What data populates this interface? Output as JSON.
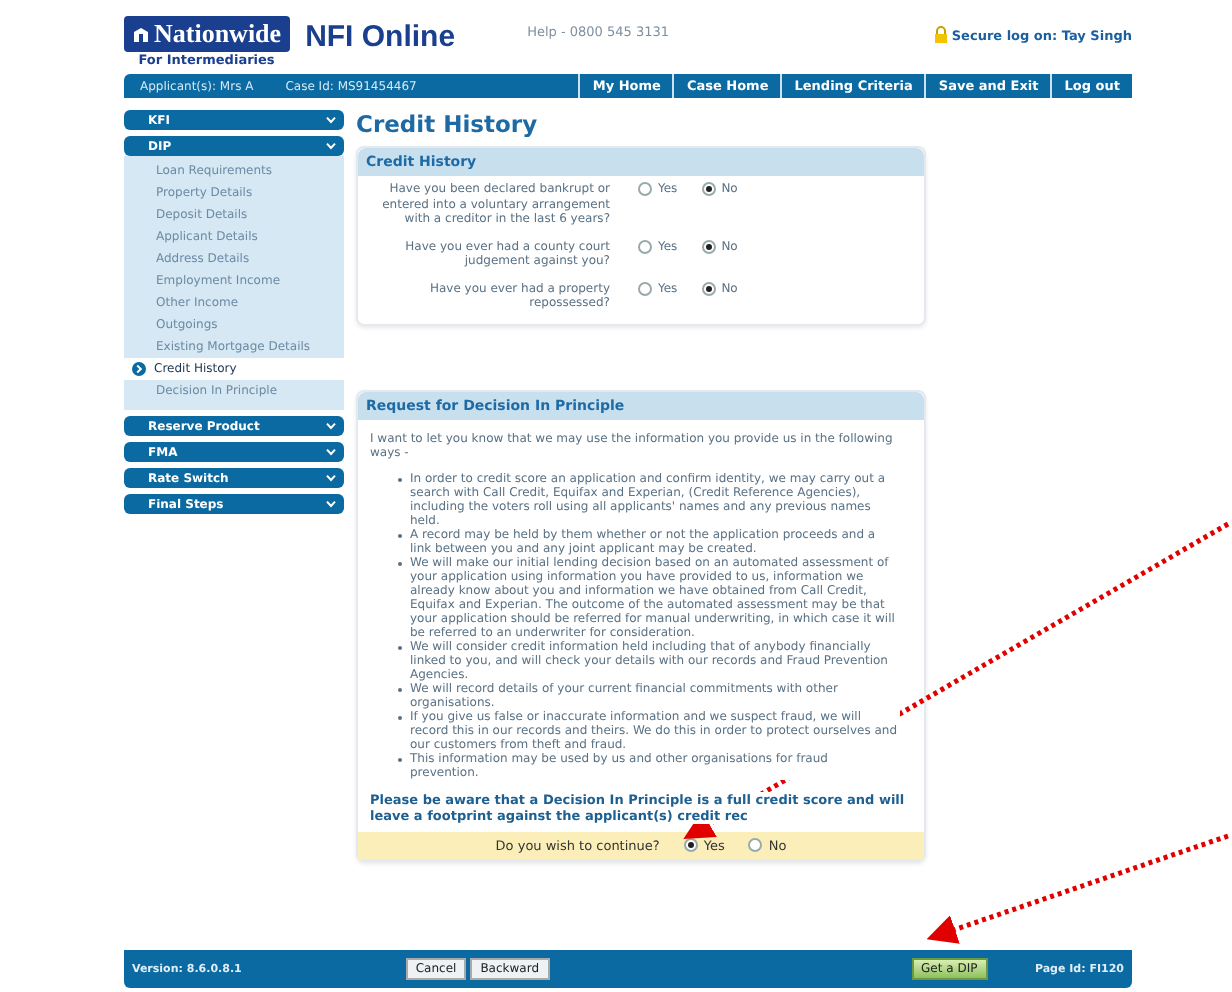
{
  "header": {
    "logo_brand": "Nationwide",
    "logo_sub": "For Intermediaries",
    "app_name": "NFI Online",
    "help": "Help - 0800 545 3131",
    "secure": "Secure log on: Tay Singh"
  },
  "info_bar": {
    "applicant": "Applicant(s): Mrs A",
    "case_id": "Case Id: MS91454467",
    "links": [
      "My Home",
      "Case Home",
      "Lending Criteria",
      "Save and Exit",
      "Log out"
    ]
  },
  "sidebar": [
    {
      "label": "KFI"
    },
    {
      "label": "DIP",
      "children": [
        {
          "label": "Loan Requirements",
          "selected": false
        },
        {
          "label": "Property Details",
          "selected": false
        },
        {
          "label": "Deposit Details",
          "selected": false
        },
        {
          "label": "Applicant Details",
          "selected": false
        },
        {
          "label": "Address Details",
          "selected": false
        },
        {
          "label": "Employment Income",
          "selected": false
        },
        {
          "label": "Other Income",
          "selected": false
        },
        {
          "label": "Outgoings",
          "selected": false
        },
        {
          "label": "Existing Mortgage Details",
          "selected": false
        },
        {
          "label": "Credit History",
          "selected": true
        },
        {
          "label": "Decision In Principle",
          "selected": false
        }
      ]
    },
    {
      "label": "Reserve Product"
    },
    {
      "label": "FMA"
    },
    {
      "label": "Rate Switch"
    },
    {
      "label": "Final Steps"
    }
  ],
  "page_title": "Credit History",
  "credit_history": {
    "title": "Credit History",
    "questions": [
      {
        "text": "Have you been declared bankrupt or entered into a voluntary arrangement with a creditor in the last 6 years?",
        "options": [
          {
            "label": "Yes",
            "selected": false
          },
          {
            "label": "No",
            "selected": true
          }
        ]
      },
      {
        "text": "Have you ever had a county court judgement against you?",
        "options": [
          {
            "label": "Yes",
            "selected": false
          },
          {
            "label": "No",
            "selected": true
          }
        ]
      },
      {
        "text": "Have you ever had a property repossessed?",
        "options": [
          {
            "label": "Yes",
            "selected": false
          },
          {
            "label": "No",
            "selected": true
          }
        ]
      }
    ]
  },
  "dip": {
    "title": "Request for Decision In Principle",
    "intro": "I want to let you know that we may use the information you provide us in the following ways -",
    "bullets": [
      "In order to credit score an application and confirm identity, we may carry out a search with Call Credit, Equifax and Experian, (Credit Reference Agencies), including the voters roll using all applicants' names and any previous names held.",
      "A record may be held by them whether or not the application proceeds and a link between you and any joint applicant may be created.",
      "We will make our initial lending decision based on an automated assessment of your application using information you have provided to us, information we already know about you and information we have obtained from Call Credit, Equifax and Experian. The outcome of the automated assessment may be that your application should be referred for manual underwriting, in which case it will be referred to an underwriter for consideration.",
      "We will consider credit information held including that of anybody financially linked to you, and will check your details with our records and Fraud Prevention Agencies.",
      "We will record details of your current financial commitments with other organisations.",
      "If you give us false or inaccurate information and we suspect fraud, we will record this in our records and theirs. We do this in order to protect ourselves and our customers from theft and fraud.",
      "This information may be used by us and other organisations for fraud prevention."
    ],
    "warning": "Please be aware that a Decision In Principle is a full credit score and will leave a footprint against the applicant(s) credit rec",
    "question": {
      "text": "Do you wish to continue?",
      "options": [
        {
          "label": "Yes",
          "selected": true
        },
        {
          "label": "No",
          "selected": false
        }
      ]
    }
  },
  "footer": {
    "version": "Version: 8.6.0.8.1",
    "buttons": [
      {
        "label": "Cancel",
        "kind": "plain"
      },
      {
        "label": "Backward",
        "kind": "plain"
      },
      {
        "label": "Get a DIP",
        "kind": "primary"
      }
    ],
    "page_id": "Page Id: FI120"
  },
  "annotations": [
    {
      "kind": "arrow"
    },
    {
      "kind": "arrow"
    }
  ]
}
